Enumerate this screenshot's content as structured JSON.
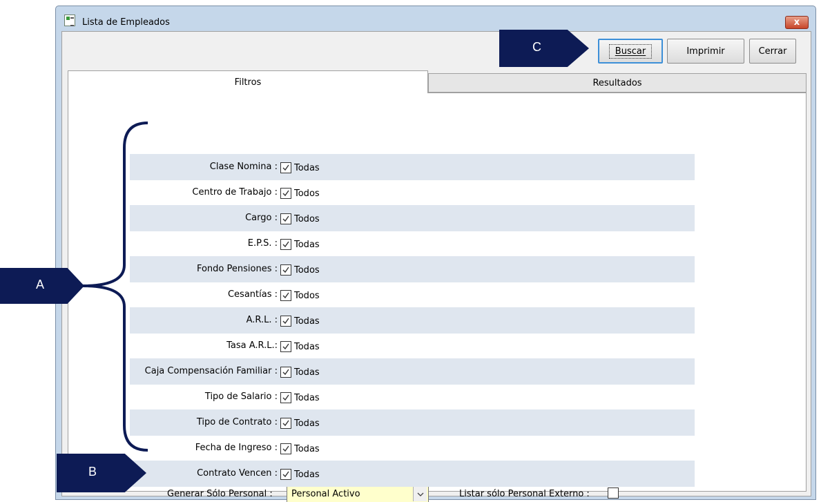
{
  "window": {
    "title": "Lista de Empleados",
    "close_label": "x"
  },
  "toolbar": {
    "buscar_label": "Buscar",
    "imprimir_label": "Imprimir",
    "cerrar_label": "Cerrar"
  },
  "tabs": [
    {
      "label": "Filtros",
      "active": true
    },
    {
      "label": "Resultados",
      "active": false
    }
  ],
  "filters": [
    {
      "label": "Clase Nomina :",
      "value": "Todas",
      "checked": true
    },
    {
      "label": "Centro de Trabajo :",
      "value": "Todos",
      "checked": true
    },
    {
      "label": "Cargo :",
      "value": "Todos",
      "checked": true
    },
    {
      "label": "E.P.S. :",
      "value": "Todas",
      "checked": true
    },
    {
      "label": "Fondo Pensiones :",
      "value": "Todos",
      "checked": true
    },
    {
      "label": "Cesantías :",
      "value": "Todos",
      "checked": true
    },
    {
      "label": "A.R.L. :",
      "value": "Todas",
      "checked": true
    },
    {
      "label": "Tasa  A.R.L.:",
      "value": "Todas",
      "checked": true
    },
    {
      "label": "Caja Compensación Familiar :",
      "value": "Todas",
      "checked": true
    },
    {
      "label": "Tipo de Salario :",
      "value": "Todas",
      "checked": true
    },
    {
      "label": "Tipo de Contrato :",
      "value": "Todas",
      "checked": true
    },
    {
      "label": "Fecha de Ingreso :",
      "value": "Todas",
      "checked": true
    },
    {
      "label": "Contrato Vencen :",
      "value": "Todas",
      "checked": true
    }
  ],
  "bottom": {
    "generar_label": "Generar Sólo Personal :",
    "generar_value": "Personal Activo",
    "externo_label": "Listar sólo Personal Externo :",
    "externo_checked": false
  },
  "callouts": {
    "a": "A",
    "b": "B",
    "c": "C"
  },
  "colors": {
    "callout": "#0d1b55",
    "row_shade": "#dfe6ef",
    "select_bg": "#ffffcc",
    "primary_border": "#3c8fd8"
  }
}
